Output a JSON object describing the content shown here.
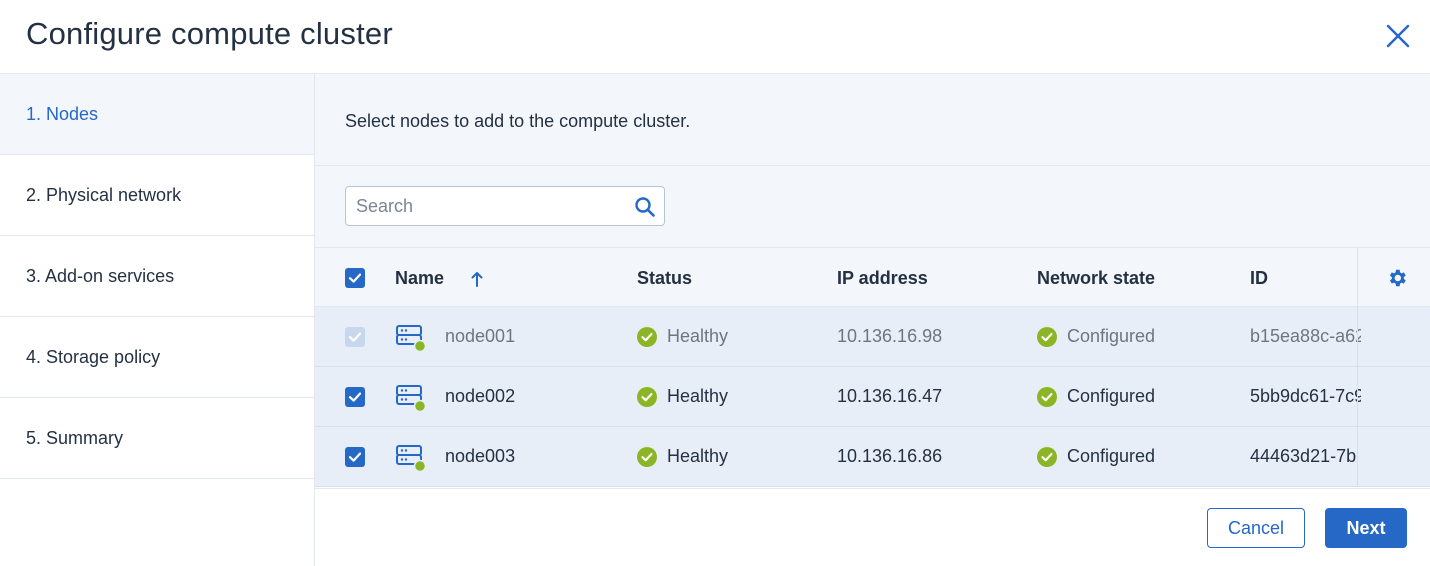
{
  "dialog": {
    "title": "Configure compute cluster"
  },
  "sidebar": {
    "steps": [
      {
        "label": "1. Nodes",
        "active": true
      },
      {
        "label": "2. Physical network",
        "active": false
      },
      {
        "label": "3. Add-on services",
        "active": false
      },
      {
        "label": "4. Storage policy",
        "active": false
      },
      {
        "label": "5. Summary",
        "active": false
      }
    ]
  },
  "main": {
    "intro": "Select nodes to add to the compute cluster.",
    "search": {
      "placeholder": "Search",
      "value": ""
    },
    "table": {
      "columns": {
        "name": "Name",
        "status": "Status",
        "ip": "IP address",
        "network_state": "Network state",
        "id": "ID"
      },
      "sort": {
        "column": "Name",
        "direction": "ascending"
      },
      "select_all_checked": true,
      "rows": [
        {
          "name": "node001",
          "status": "Healthy",
          "ip": "10.136.16.98",
          "network_state": "Configured",
          "id": "b15ea88c-a62",
          "checked": true,
          "disabled": true
        },
        {
          "name": "node002",
          "status": "Healthy",
          "ip": "10.136.16.47",
          "network_state": "Configured",
          "id": "5bb9dc61-7c9",
          "checked": true,
          "disabled": false
        },
        {
          "name": "node003",
          "status": "Healthy",
          "ip": "10.136.16.86",
          "network_state": "Configured",
          "id": "44463d21-7b",
          "checked": true,
          "disabled": false
        }
      ]
    }
  },
  "footer": {
    "cancel_label": "Cancel",
    "next_label": "Next"
  },
  "colors": {
    "accent": "#2668c5",
    "healthy": "#8ab625",
    "text": "#243143",
    "panel_bg": "#f3f6fa",
    "selected_row_bg": "#e8eef7"
  },
  "icons": {
    "close": "close-icon",
    "search": "search-icon",
    "settings": "gear-icon",
    "sort": "sort-ascending-icon",
    "node": "server-node-icon",
    "status_ok": "check-circle-icon"
  }
}
